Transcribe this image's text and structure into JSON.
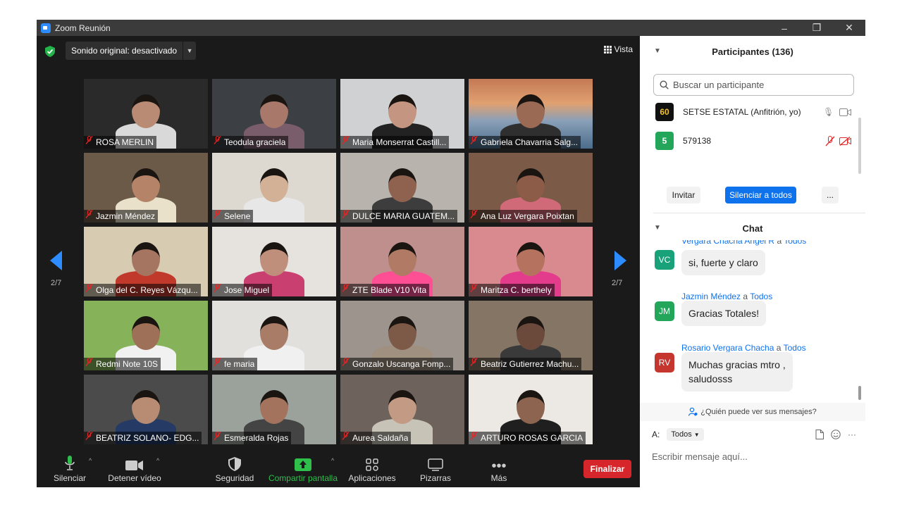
{
  "window": {
    "title": "Zoom Reunión",
    "controls": [
      "–",
      "❐",
      "✕"
    ]
  },
  "meeting": {
    "audio_label": "Sonido original: desactivado",
    "view_label": "Vista",
    "page_left": "2/7",
    "page_right": "2/7",
    "tiles": [
      {
        "name": "ROSA MERLIN"
      },
      {
        "name": "Teodula graciela"
      },
      {
        "name": "Maria Monserrat Castill..."
      },
      {
        "name": "Gabriela Chavarria Salg..."
      },
      {
        "name": "Jazmin Méndez"
      },
      {
        "name": "Selene"
      },
      {
        "name": "DULCE MARIA GUATEM..."
      },
      {
        "name": "Ana Luz Vergara Poixtan"
      },
      {
        "name": "Olga del C. Reyes Vázqu..."
      },
      {
        "name": "Jose Miguel"
      },
      {
        "name": "ZTE Blade V10 Vita"
      },
      {
        "name": "Maritza C. berthely"
      },
      {
        "name": "Redmi Note 10S"
      },
      {
        "name": "fe maria"
      },
      {
        "name": "Gonzalo Uscanga Fomp..."
      },
      {
        "name": "Beatriz Gutierrez Machu..."
      },
      {
        "name": "BEATRIZ SOLANO- EDG..."
      },
      {
        "name": "Esmeralda Rojas"
      },
      {
        "name": "Aurea Saldaña"
      },
      {
        "name": "ARTURO ROSAS GARCIA"
      }
    ]
  },
  "toolbar": {
    "mute": "Silenciar",
    "video": "Detener vídeo",
    "security": "Seguridad",
    "share": "Compartir pantalla",
    "apps": "Aplicaciones",
    "whiteboards": "Pizarras",
    "more": "Más",
    "end": "Finalizar"
  },
  "participants": {
    "header": "Participantes (136)",
    "search_placeholder": "Buscar un participante",
    "list": [
      {
        "avatar": "60",
        "name": "SETSE ESTATAL (Anfitrión, yo)"
      },
      {
        "avatar": "5",
        "name": "579138"
      }
    ],
    "invite": "Invitar",
    "mute_all": "Silenciar a todos",
    "more": "..."
  },
  "chat": {
    "header": "Chat",
    "messages": [
      {
        "initials": "VC",
        "sender": "Vergara Chacha Angel R",
        "to": "a",
        "target": "Todos",
        "text": "si, fuerte y claro"
      },
      {
        "initials": "JM",
        "sender": "Jazmin Méndez",
        "to": "a",
        "target": "Todos",
        "text": "Gracias Totales!"
      },
      {
        "initials": "RV",
        "sender": "Rosario Vergara Chacha",
        "to": "a",
        "target": "Todos",
        "text_line1": "Muchas gracias mtro ,",
        "text_line2": "saludosss"
      }
    ],
    "who_sees": "¿Quién puede ver sus mensajes?",
    "to_label": "A:",
    "to_value": "Todos",
    "input_placeholder": "Escribir mensaje aquí..."
  },
  "colors": {
    "accent": "#2d8cff",
    "end_button": "#d7262b",
    "share_green": "#22c55e",
    "muted_red": "#e02828"
  }
}
